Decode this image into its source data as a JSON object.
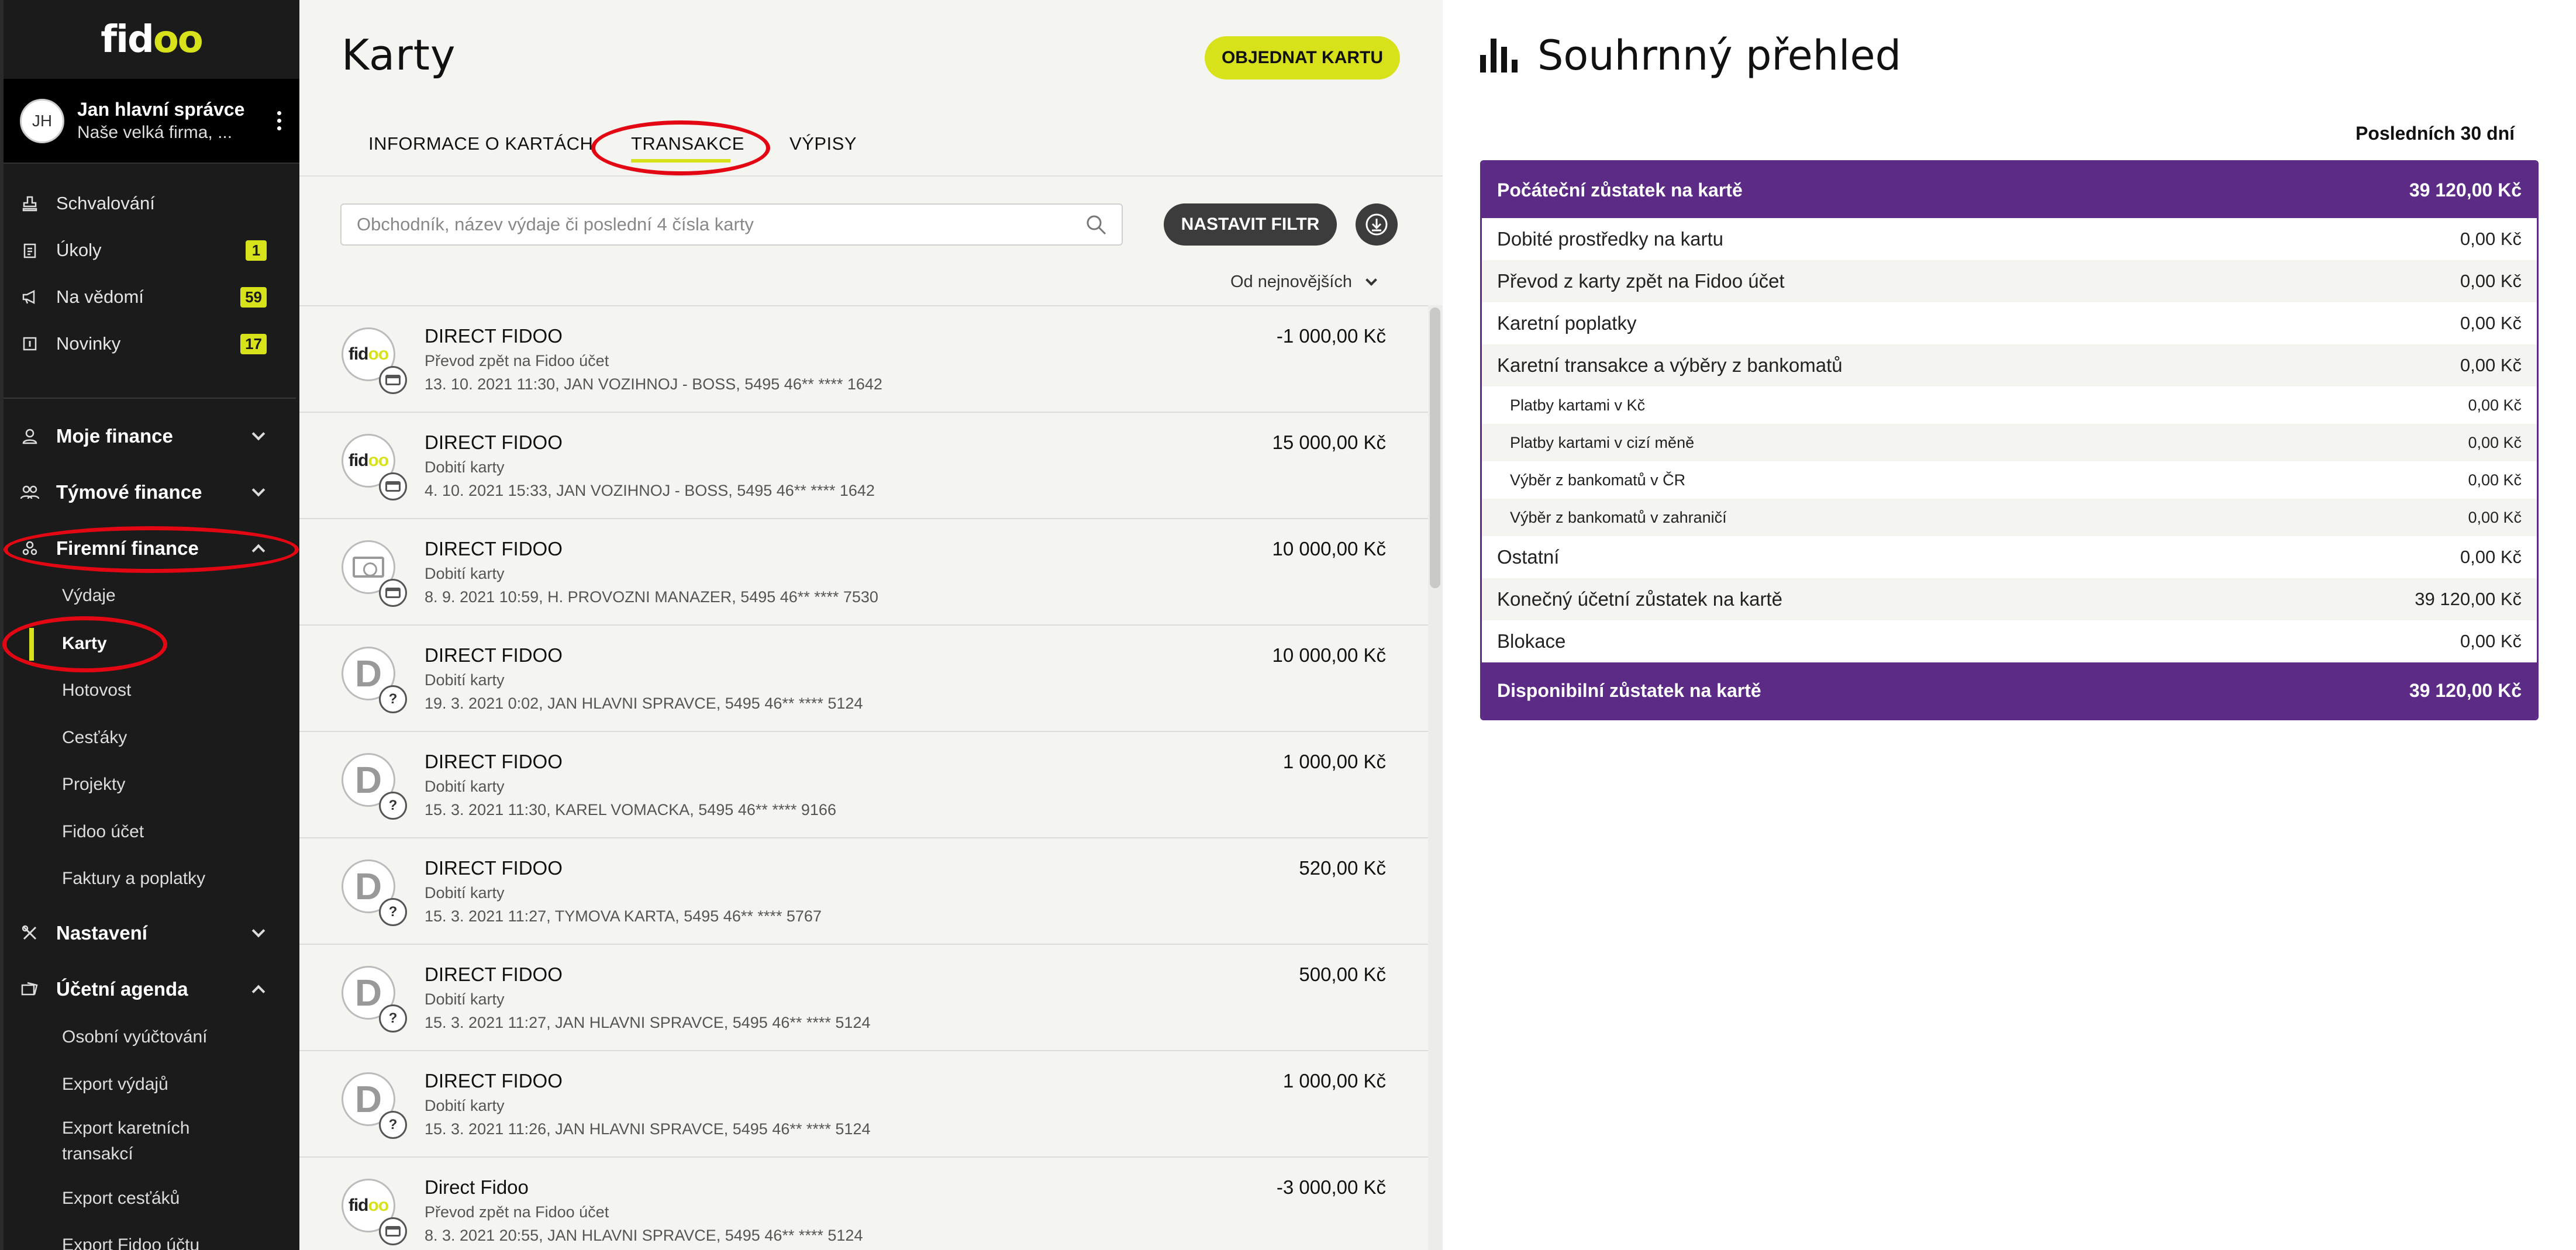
{
  "sidebar": {
    "logo": {
      "pre": "fid",
      "oo": "oo"
    },
    "user": {
      "initials": "JH",
      "name": "Jan hlavní správce",
      "company": "Naše velká firma, ..."
    },
    "top_items": [
      {
        "label": "Schvalování",
        "icon": "approval-icon",
        "badge": ""
      },
      {
        "label": "Úkoly",
        "icon": "clipboard-icon",
        "badge": "1"
      },
      {
        "label": "Na vědomí",
        "icon": "megaphone-icon",
        "badge": "59"
      },
      {
        "label": "Novinky",
        "icon": "news-icon",
        "badge": "17"
      }
    ],
    "sections": {
      "moje": "Moje finance",
      "tymove": "Týmové finance",
      "firemni": "Firemní finance",
      "firemni_items": [
        "Výdaje",
        "Karty",
        "Hotovost",
        "Cesťáky",
        "Projekty",
        "Fidoo účet",
        "Faktury a poplatky"
      ],
      "nastaveni": "Nastavení",
      "ucetni": "Účetní agenda",
      "ucetni_items": [
        "Osobní vyúčtování",
        "Export výdajů",
        "Export karetních transakcí",
        "Export cesťáků",
        "Export Fidoo účtu"
      ]
    },
    "active_item": "Karty"
  },
  "main": {
    "title": "Karty",
    "order_button": "OBJEDNAT KARTU",
    "tabs": [
      "INFORMACE O KARTÁCH",
      "TRANSAKCE",
      "VÝPISY"
    ],
    "active_tab": "TRANSAKCE",
    "search_placeholder": "Obchodník, název výdaje či poslední 4 čísla karty",
    "filter_button": "NASTAVIT FILTR",
    "sort_label": "Od nejnovějších",
    "transactions": [
      {
        "logo": "fidoo",
        "badge": "card",
        "name": "DIRECT FIDOO",
        "desc": "Převod zpět na Fidoo účet",
        "meta": "13. 10. 2021 11:30, JAN VOZIHNOJ - BOSS, 5495 46** **** 1642",
        "amount": "-1 000,00 Kč"
      },
      {
        "logo": "fidoo",
        "badge": "card",
        "name": "DIRECT FIDOO",
        "desc": "Dobití karty",
        "meta": "4. 10. 2021 15:33, JAN VOZIHNOJ - BOSS, 5495 46** **** 1642",
        "amount": "15 000,00 Kč"
      },
      {
        "logo": "money",
        "badge": "card",
        "name": "DIRECT FIDOO",
        "desc": "Dobití karty",
        "meta": "8. 9. 2021 10:59, H. PROVOZNI MANAZER, 5495 46** **** 7530",
        "amount": "10 000,00 Kč"
      },
      {
        "logo": "D",
        "badge": "?",
        "name": "DIRECT FIDOO",
        "desc": "Dobití karty",
        "meta": "19. 3. 2021 0:02, JAN HLAVNI SPRAVCE, 5495 46** **** 5124",
        "amount": "10 000,00 Kč"
      },
      {
        "logo": "D",
        "badge": "?",
        "name": "DIRECT FIDOO",
        "desc": "Dobití karty",
        "meta": "15. 3. 2021 11:30, KAREL VOMACKA, 5495 46** **** 9166",
        "amount": "1 000,00 Kč"
      },
      {
        "logo": "D",
        "badge": "?",
        "name": "DIRECT FIDOO",
        "desc": "Dobití karty",
        "meta": "15. 3. 2021 11:27, TYMOVA KARTA, 5495 46** **** 5767",
        "amount": "520,00 Kč"
      },
      {
        "logo": "D",
        "badge": "?",
        "name": "DIRECT FIDOO",
        "desc": "Dobití karty",
        "meta": "15. 3. 2021 11:27, JAN HLAVNI SPRAVCE, 5495 46** **** 5124",
        "amount": "500,00 Kč"
      },
      {
        "logo": "D",
        "badge": "?",
        "name": "DIRECT FIDOO",
        "desc": "Dobití karty",
        "meta": "15. 3. 2021 11:26, JAN HLAVNI SPRAVCE, 5495 46** **** 5124",
        "amount": "1 000,00 Kč"
      },
      {
        "logo": "fidoo",
        "badge": "cards",
        "name": "Direct Fidoo",
        "desc": "Převod zpět na Fidoo účet",
        "meta": "8. 3. 2021 20:55, JAN HLAVNI SPRAVCE, 5495 46** **** 5124",
        "amount": "-3 000,00 Kč"
      }
    ]
  },
  "summary": {
    "title": "Souhrnný přehled",
    "period": "Posledních 30 dní",
    "head": {
      "label": "Počáteční zůstatek na kartě",
      "value": "39 120,00 Kč"
    },
    "rows": [
      {
        "label": "Dobité prostředky na kartu",
        "value": "0,00 Kč",
        "sub": false
      },
      {
        "label": "Převod z karty zpět na Fidoo účet",
        "value": "0,00 Kč",
        "sub": false
      },
      {
        "label": "Karetní poplatky",
        "value": "0,00 Kč",
        "sub": false
      },
      {
        "label": "Karetní transakce a výběry z bankomatů",
        "value": "0,00 Kč",
        "sub": false
      },
      {
        "label": "Platby kartami v Kč",
        "value": "0,00 Kč",
        "sub": true
      },
      {
        "label": "Platby kartami v cizí měně",
        "value": "0,00 Kč",
        "sub": true
      },
      {
        "label": "Výběr z bankomatů v ČR",
        "value": "0,00 Kč",
        "sub": true
      },
      {
        "label": "Výběr z bankomatů v zahraničí",
        "value": "0,00 Kč",
        "sub": true
      },
      {
        "label": "Ostatní",
        "value": "0,00 Kč",
        "sub": false
      },
      {
        "label": "Konečný účetní zůstatek na kartě",
        "value": "39 120,00 Kč",
        "sub": false
      },
      {
        "label": "Blokace",
        "value": "0,00 Kč",
        "sub": false
      }
    ],
    "foot": {
      "label": "Disponibilní zůstatek na kartě",
      "value": "39 120,00 Kč"
    }
  },
  "colors": {
    "accent": "#d7e21b",
    "purple": "#5b2b86",
    "annotation": "#e30613",
    "sidebar": "#1b1b1b"
  }
}
